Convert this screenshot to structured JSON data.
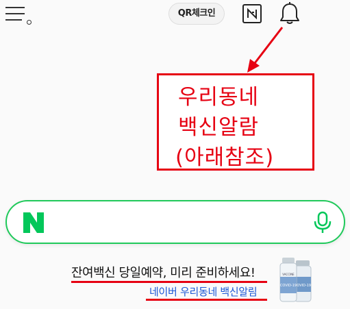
{
  "header": {
    "qr_checkin_label": "QR체크인",
    "icons": [
      "menu-icon",
      "naver-n-icon",
      "bell-icon"
    ]
  },
  "annotation": {
    "lines": [
      "우리동네",
      "백신알람",
      "(아래참조)"
    ],
    "color": "#e60012"
  },
  "search": {
    "logo_letter": "N",
    "value": "",
    "accent": "#1fc95a"
  },
  "banner": {
    "headline": "잔여백신 당일예약, 미리 준비하세요!",
    "link": "네이버 우리동네 백신알림",
    "vial_label": "VACCINE COVID-19",
    "link_color": "#1a56d6"
  }
}
